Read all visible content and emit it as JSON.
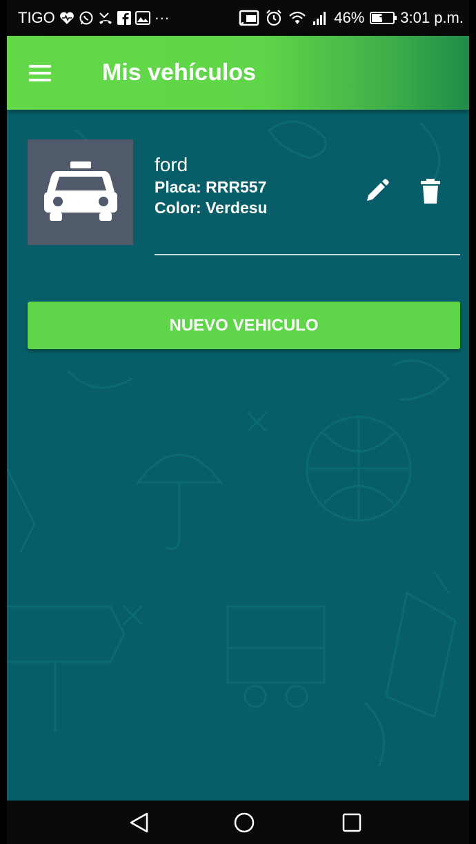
{
  "status_bar": {
    "carrier": "TIGO",
    "overflow": "···",
    "battery": "46%",
    "battery_level": 0.46,
    "time": "3:01 p.m."
  },
  "app_bar": {
    "title": "Mis vehículos",
    "menu_icon": "hamburger-menu-icon"
  },
  "vehicles": [
    {
      "name": "ford",
      "plate_line": "Placa: RRR557",
      "color_line": "Color: Verdesu",
      "icon": "taxi-icon"
    }
  ],
  "actions": {
    "new_vehicle_label": "NUEVO VEHICULO"
  },
  "colors": {
    "background": "#075e69",
    "accent_green": "#5fd649",
    "thumb_bg": "#515a6b"
  }
}
